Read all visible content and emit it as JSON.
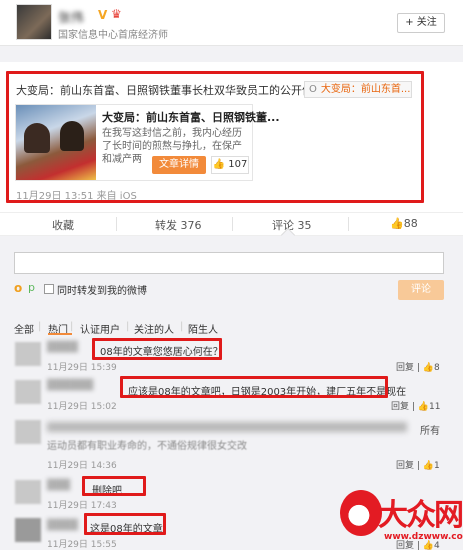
{
  "profile": {
    "name": "张伟",
    "desc": "国家信息中心首席经济师",
    "follow_label": "+ 关注"
  },
  "post": {
    "title": "大变局：前山东首富、日照钢铁董事长杜双华致员工的公开信",
    "chip_text": "大变局：前山东首...",
    "article": {
      "title": "大变局：前山东首富、日照钢铁董...",
      "excerpt": "在我写这封信之前，我内心经历了长时间的煎熬与挣扎，在保产和减产两",
      "button": "文章详情",
      "likes": "107"
    },
    "time": "11月29日 13:51 来自 iOS"
  },
  "actions": {
    "collect": "收藏",
    "repost": "转发 376",
    "comment": "评论 35",
    "like": "88"
  },
  "composer": {
    "checkbox_label": "同时转发到我的微博",
    "submit": "评论"
  },
  "filters": [
    "全部",
    "热门",
    "认证用户",
    "关注的人",
    "陌生人"
  ],
  "comments": [
    {
      "text": "08年的文章您悠居心何在？",
      "time": "11月29日 15:39",
      "reply": "回复",
      "likes": "8"
    },
    {
      "text": "应该是08年的文章吧，日钢是2003年开始，建厂五年不是现在",
      "time": "11月29日 15:02",
      "reply": "回复",
      "likes": "11"
    },
    {
      "text": "运动员都有职业寿命的，不通俗规律很女交改",
      "time": "11月29日 14:36",
      "reply": "回复",
      "likes": "1",
      "suffix": "所有"
    },
    {
      "text": "删除吧",
      "time": "11月29日 17:43",
      "reply": "回复",
      "likes": ""
    },
    {
      "text": "这是08年的文章",
      "time": "11月29日 15:55",
      "reply": "回复",
      "likes": "4"
    }
  ],
  "watermark": {
    "logo_text": "大众网",
    "url": "www.dzwww.com"
  },
  "colors": {
    "highlight_red": "#e01a1a",
    "accent_orange": "#f28a3a",
    "link_orange": "#e8640c"
  }
}
